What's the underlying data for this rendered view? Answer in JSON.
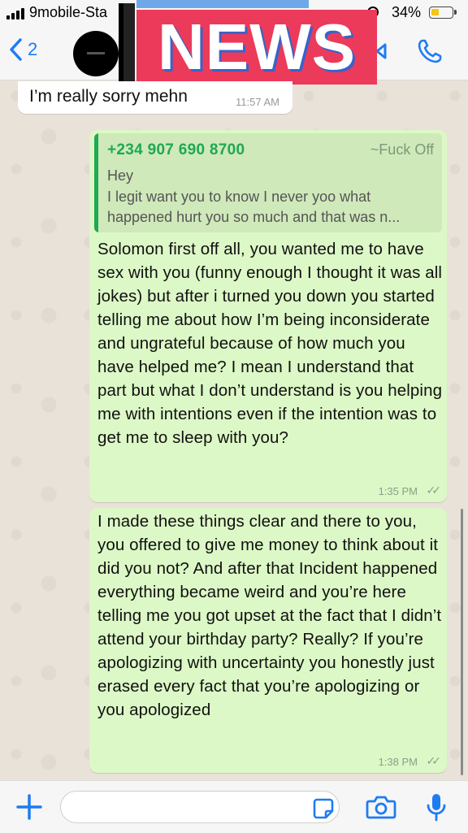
{
  "status_bar": {
    "carrier": "9mobile-Sta",
    "battery": "34%"
  },
  "header": {
    "back_count": "2",
    "overlay_text": "NEWS"
  },
  "messages": {
    "incoming": {
      "text": "I’m really sorry mehn",
      "time": "11:57 AM"
    },
    "reply": {
      "quote_sender": "+234 907 690 8700",
      "quote_alias": "~Fuck Off",
      "quote_line1": "Hey",
      "quote_line2": "I legit want you to know I never yoo what happened hurt you so much and that was n...",
      "text": "Solomon first off all, you wanted me to have sex with you (funny enough I thought it was all jokes) but after i turned you down you started telling me about how I’m being inconsiderate and ungrateful because of how much you have helped me? I mean I understand that part but what I don’t understand is you helping me with intentions even if the intention was to get me to sleep with you?",
      "time": "1:35 PM"
    },
    "followup": {
      "text": "I made these things clear and there to you, you offered to give me money to think about it did you not? And after that Incident happened everything became weird and you’re here telling me you got upset at the fact that I didn’t attend your birthday party? Really? If you’re apologizing with uncertainty you honestly just erased every fact that you’re apologizing or you apologized",
      "time": "1:38 PM"
    }
  },
  "icons": {
    "back": "chevron-left-icon",
    "video": "video-call-icon",
    "call": "phone-icon",
    "attach": "plus-icon",
    "sticker": "sticker-icon",
    "camera": "camera-icon",
    "mic": "microphone-icon"
  },
  "colors": {
    "accent": "#1E7CF2",
    "outgoing_bubble": "#DCF8C6",
    "quote_sender": "#1FA855",
    "news_banner": "#EC3A5B"
  }
}
